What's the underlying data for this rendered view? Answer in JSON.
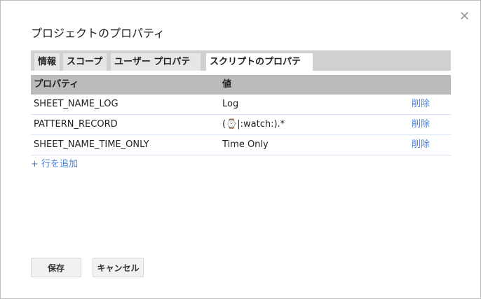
{
  "dialog": {
    "title": "プロジェクトのプロパティ",
    "close_icon": "close-icon"
  },
  "tabs": [
    {
      "label": "情報",
      "active": false
    },
    {
      "label": "スコープ",
      "active": false
    },
    {
      "label": "ユーザー プロパティ",
      "active": false
    },
    {
      "label": "スクリプトのプロパティ",
      "active": true
    }
  ],
  "table": {
    "headers": [
      "プロパティ",
      "値"
    ],
    "rows": [
      {
        "property": "SHEET_NAME_LOG",
        "value": "Log",
        "action": "削除"
      },
      {
        "property": "PATTERN_RECORD",
        "value": "(⌚|:watch:).*",
        "action": "削除"
      },
      {
        "property": "SHEET_NAME_TIME_ONLY",
        "value": "Time Only",
        "action": "削除"
      }
    ]
  },
  "add_row": "+ 行を追加",
  "buttons": {
    "save": "保存",
    "cancel": "キャンセル"
  },
  "colors": {
    "link": "#4a7fd6",
    "tabbar": "#d0d0d0",
    "header": "#bbbbbb"
  }
}
